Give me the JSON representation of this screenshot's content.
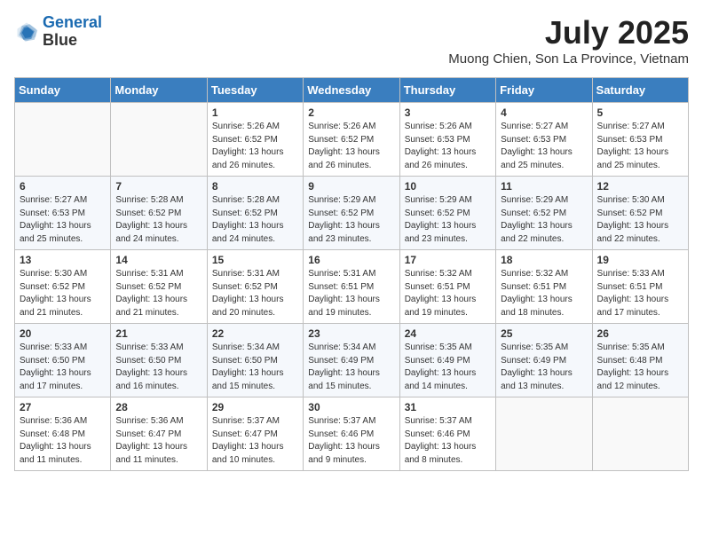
{
  "logo": {
    "line1": "General",
    "line2": "Blue"
  },
  "title": "July 2025",
  "location": "Muong Chien, Son La Province, Vietnam",
  "days_of_week": [
    "Sunday",
    "Monday",
    "Tuesday",
    "Wednesday",
    "Thursday",
    "Friday",
    "Saturday"
  ],
  "weeks": [
    [
      {
        "day": "",
        "info": ""
      },
      {
        "day": "",
        "info": ""
      },
      {
        "day": "1",
        "info": "Sunrise: 5:26 AM\nSunset: 6:52 PM\nDaylight: 13 hours and 26 minutes."
      },
      {
        "day": "2",
        "info": "Sunrise: 5:26 AM\nSunset: 6:52 PM\nDaylight: 13 hours and 26 minutes."
      },
      {
        "day": "3",
        "info": "Sunrise: 5:26 AM\nSunset: 6:53 PM\nDaylight: 13 hours and 26 minutes."
      },
      {
        "day": "4",
        "info": "Sunrise: 5:27 AM\nSunset: 6:53 PM\nDaylight: 13 hours and 25 minutes."
      },
      {
        "day": "5",
        "info": "Sunrise: 5:27 AM\nSunset: 6:53 PM\nDaylight: 13 hours and 25 minutes."
      }
    ],
    [
      {
        "day": "6",
        "info": "Sunrise: 5:27 AM\nSunset: 6:53 PM\nDaylight: 13 hours and 25 minutes."
      },
      {
        "day": "7",
        "info": "Sunrise: 5:28 AM\nSunset: 6:52 PM\nDaylight: 13 hours and 24 minutes."
      },
      {
        "day": "8",
        "info": "Sunrise: 5:28 AM\nSunset: 6:52 PM\nDaylight: 13 hours and 24 minutes."
      },
      {
        "day": "9",
        "info": "Sunrise: 5:29 AM\nSunset: 6:52 PM\nDaylight: 13 hours and 23 minutes."
      },
      {
        "day": "10",
        "info": "Sunrise: 5:29 AM\nSunset: 6:52 PM\nDaylight: 13 hours and 23 minutes."
      },
      {
        "day": "11",
        "info": "Sunrise: 5:29 AM\nSunset: 6:52 PM\nDaylight: 13 hours and 22 minutes."
      },
      {
        "day": "12",
        "info": "Sunrise: 5:30 AM\nSunset: 6:52 PM\nDaylight: 13 hours and 22 minutes."
      }
    ],
    [
      {
        "day": "13",
        "info": "Sunrise: 5:30 AM\nSunset: 6:52 PM\nDaylight: 13 hours and 21 minutes."
      },
      {
        "day": "14",
        "info": "Sunrise: 5:31 AM\nSunset: 6:52 PM\nDaylight: 13 hours and 21 minutes."
      },
      {
        "day": "15",
        "info": "Sunrise: 5:31 AM\nSunset: 6:52 PM\nDaylight: 13 hours and 20 minutes."
      },
      {
        "day": "16",
        "info": "Sunrise: 5:31 AM\nSunset: 6:51 PM\nDaylight: 13 hours and 19 minutes."
      },
      {
        "day": "17",
        "info": "Sunrise: 5:32 AM\nSunset: 6:51 PM\nDaylight: 13 hours and 19 minutes."
      },
      {
        "day": "18",
        "info": "Sunrise: 5:32 AM\nSunset: 6:51 PM\nDaylight: 13 hours and 18 minutes."
      },
      {
        "day": "19",
        "info": "Sunrise: 5:33 AM\nSunset: 6:51 PM\nDaylight: 13 hours and 17 minutes."
      }
    ],
    [
      {
        "day": "20",
        "info": "Sunrise: 5:33 AM\nSunset: 6:50 PM\nDaylight: 13 hours and 17 minutes."
      },
      {
        "day": "21",
        "info": "Sunrise: 5:33 AM\nSunset: 6:50 PM\nDaylight: 13 hours and 16 minutes."
      },
      {
        "day": "22",
        "info": "Sunrise: 5:34 AM\nSunset: 6:50 PM\nDaylight: 13 hours and 15 minutes."
      },
      {
        "day": "23",
        "info": "Sunrise: 5:34 AM\nSunset: 6:49 PM\nDaylight: 13 hours and 15 minutes."
      },
      {
        "day": "24",
        "info": "Sunrise: 5:35 AM\nSunset: 6:49 PM\nDaylight: 13 hours and 14 minutes."
      },
      {
        "day": "25",
        "info": "Sunrise: 5:35 AM\nSunset: 6:49 PM\nDaylight: 13 hours and 13 minutes."
      },
      {
        "day": "26",
        "info": "Sunrise: 5:35 AM\nSunset: 6:48 PM\nDaylight: 13 hours and 12 minutes."
      }
    ],
    [
      {
        "day": "27",
        "info": "Sunrise: 5:36 AM\nSunset: 6:48 PM\nDaylight: 13 hours and 11 minutes."
      },
      {
        "day": "28",
        "info": "Sunrise: 5:36 AM\nSunset: 6:47 PM\nDaylight: 13 hours and 11 minutes."
      },
      {
        "day": "29",
        "info": "Sunrise: 5:37 AM\nSunset: 6:47 PM\nDaylight: 13 hours and 10 minutes."
      },
      {
        "day": "30",
        "info": "Sunrise: 5:37 AM\nSunset: 6:46 PM\nDaylight: 13 hours and 9 minutes."
      },
      {
        "day": "31",
        "info": "Sunrise: 5:37 AM\nSunset: 6:46 PM\nDaylight: 13 hours and 8 minutes."
      },
      {
        "day": "",
        "info": ""
      },
      {
        "day": "",
        "info": ""
      }
    ]
  ]
}
